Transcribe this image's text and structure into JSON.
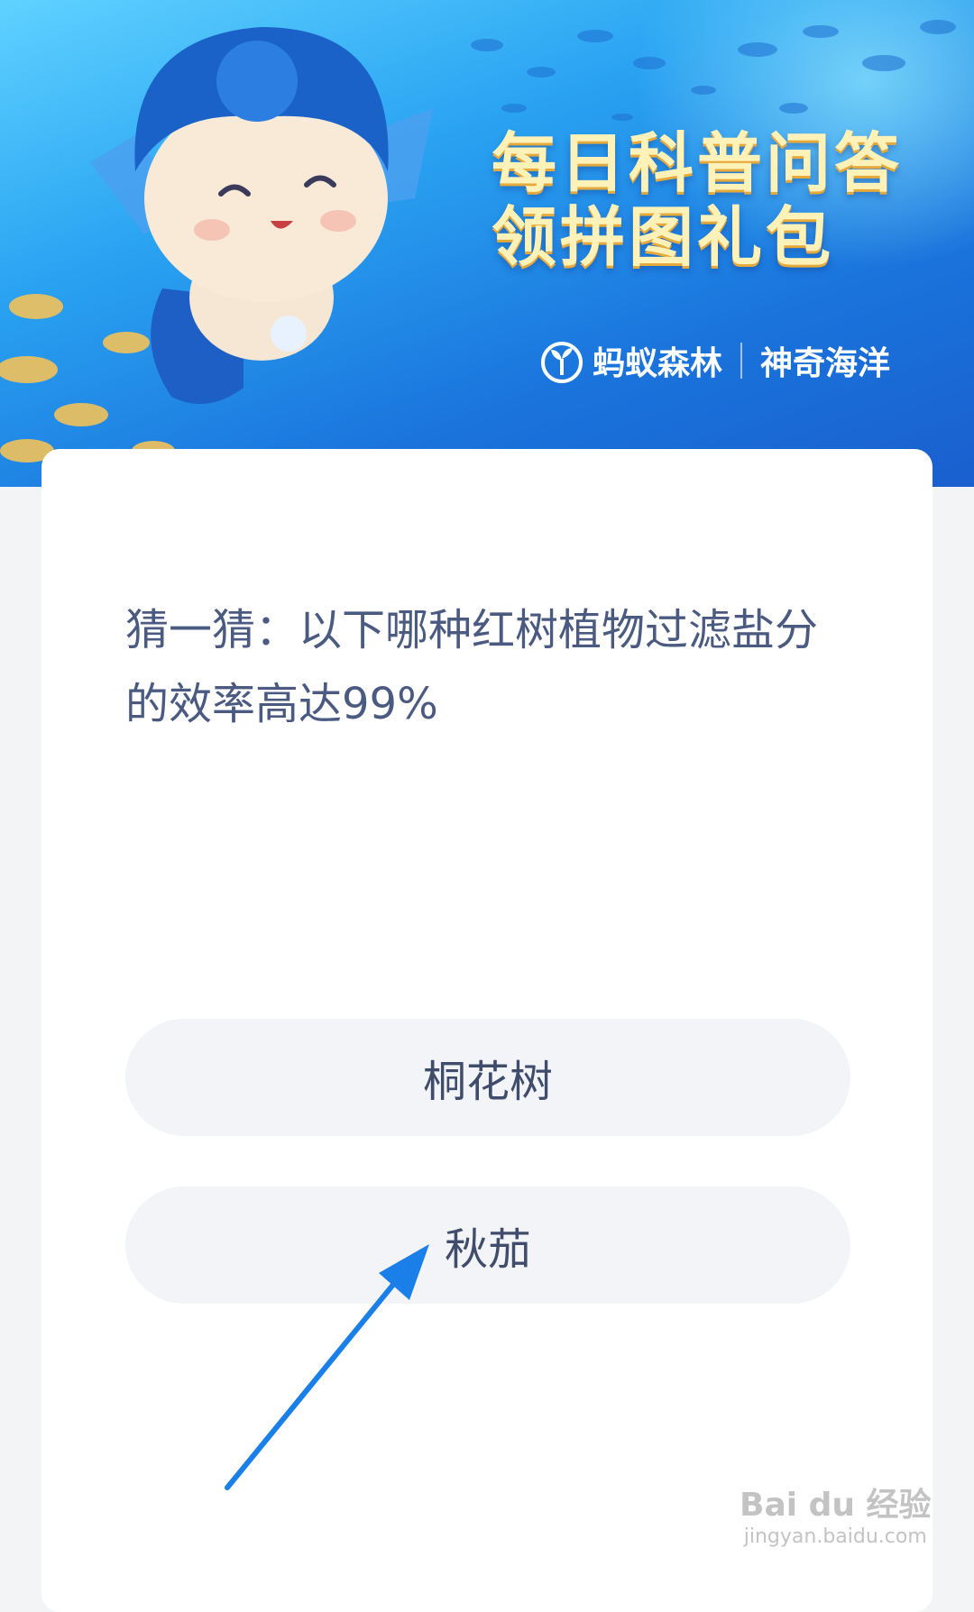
{
  "banner": {
    "title_line1": "每日科普问答",
    "title_line2": "领拼图礼包",
    "brand_left": "蚂蚁森林",
    "brand_right": "神奇海洋",
    "logo_icon": "sprout-icon",
    "mascot_icon": "mermaid-character-icon"
  },
  "quiz": {
    "question": "猜一猜：以下哪种红树植物过滤盐分的效率高达99%",
    "options": [
      {
        "label": "桐花树"
      },
      {
        "label": "秋茄"
      }
    ]
  },
  "annotation": {
    "arrow_icon": "pointer-arrow-icon",
    "arrow_color": "#1a7fe8"
  },
  "watermark": {
    "brand": "Bai du 经验",
    "url": "jingyan.baidu.com"
  },
  "colors": {
    "page_bg": "#f3f4f6",
    "card_bg": "#ffffff",
    "option_bg": "#f2f4f7",
    "question_text": "#4a5a80",
    "banner_title": "#fff2b8"
  }
}
